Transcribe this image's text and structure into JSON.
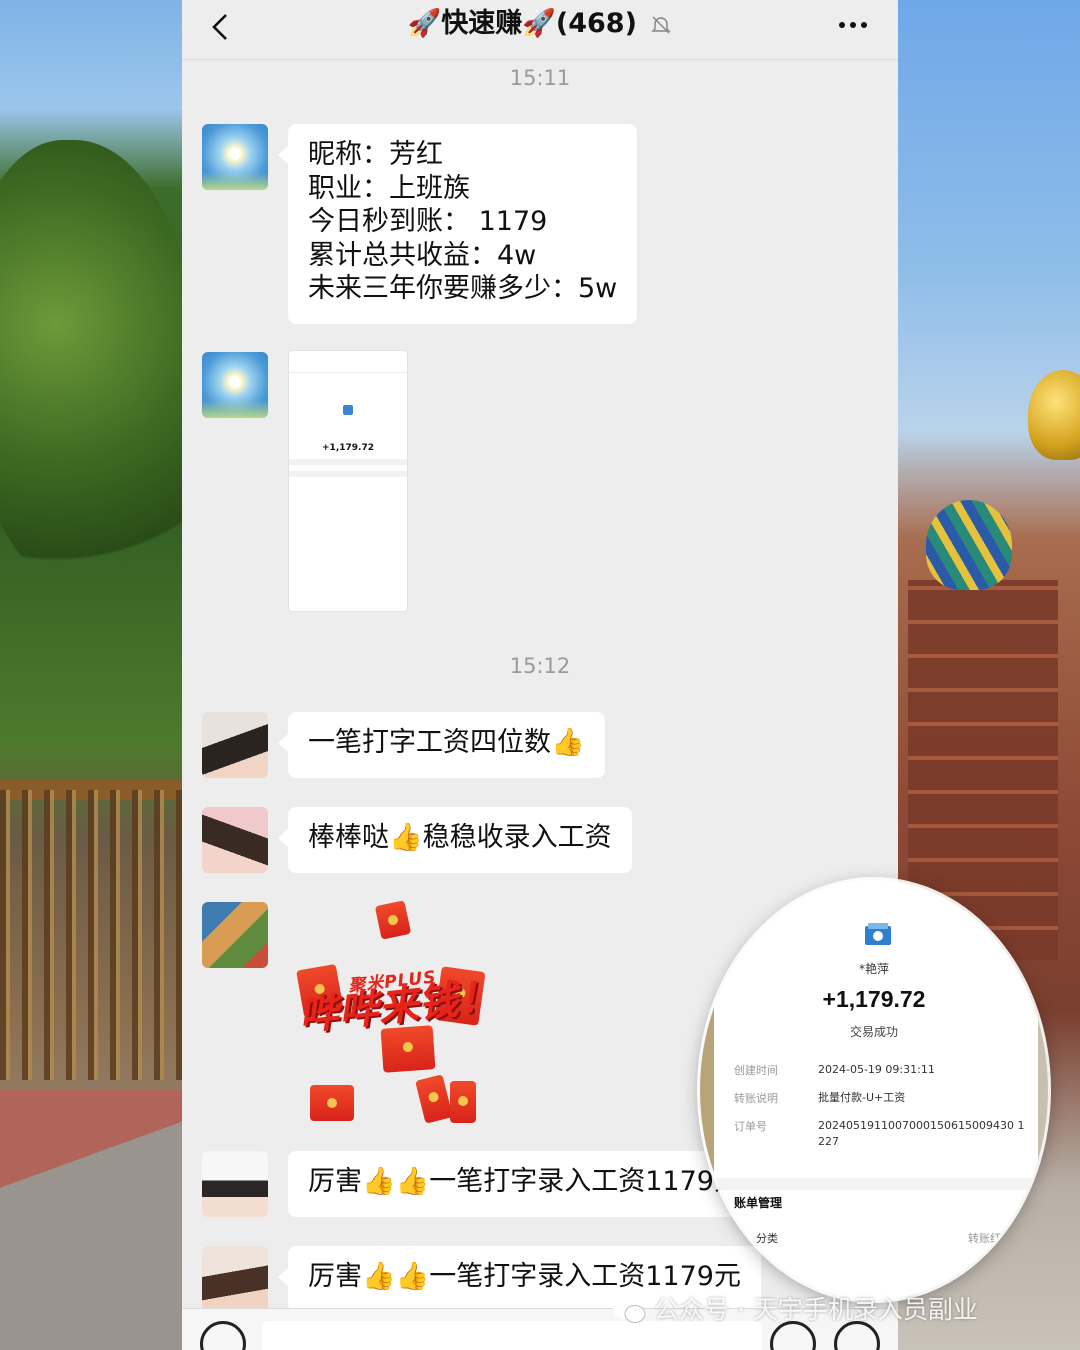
{
  "header": {
    "title": "🚀快速赚🚀(468)"
  },
  "timestamps": [
    "15:11",
    "15:12"
  ],
  "messages": {
    "intro": {
      "lines": [
        "昵称：芳红",
        "职业：上班族",
        "今日秒到账： 1179",
        "累计总共收益：4w",
        "未来三年你要赚多少：5w"
      ]
    },
    "m1": "一笔打字工资四位数👍",
    "m2": "棒棒哒👍稳稳收录入工资",
    "m3": "厉害👍👍一笔打字录入工资1179元",
    "m4": "厉害👍👍一笔打字录入工资1179元"
  },
  "sticker": {
    "top": "聚米PLUS",
    "main": "哔哔来钱！"
  },
  "receipt_thumb": {
    "amount": "+1,179.72"
  },
  "receipt_zoom": {
    "payer": "*艳萍",
    "amount": "+1,179.72",
    "status": "交易成功",
    "rows": [
      {
        "k": "创建时间",
        "v": "2024-05-19 09:31:11"
      },
      {
        "k": "转账说明",
        "v": "批量付款-U+工资"
      },
      {
        "k": "订单号",
        "v": "2024051911007000150615009430 1227"
      }
    ],
    "section": "账单管理",
    "category_label": "分类",
    "category_value": "转账红"
  },
  "watermark": "公众号 · 天宇手机录入员副业",
  "colors": {
    "chat_bg": "#ededed",
    "bubble": "#ffffff",
    "timestamp": "#9a9a9a",
    "envelope_red": "#e8231a"
  }
}
